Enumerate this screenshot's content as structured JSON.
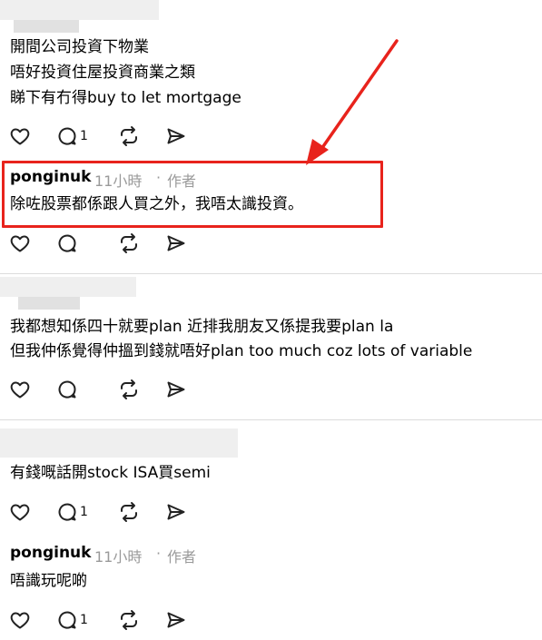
{
  "posts": [
    {
      "lines": [
        "開間公司投資下物業",
        "唔好投資住屋投資商業之類",
        "睇下有冇得buy to let mortgage"
      ],
      "reply_count": "1"
    },
    {
      "username": "ponginuk",
      "time": "11小時",
      "role": "作者",
      "lines": [
        "除咗股票都係跟人買之外，我唔太識投資。"
      ],
      "reply_count": ""
    },
    {
      "lines": [
        "我都想知係四十就要plan 近排我朋友又係提我要plan la",
        "但我仲係覺得仲搵到錢就唔好plan too much coz lots of variable"
      ],
      "reply_count": ""
    },
    {
      "lines": [
        "有錢嘅話開stock ISA買semi"
      ],
      "reply_count": "1"
    },
    {
      "username": "ponginuk",
      "time": "11小時",
      "role": "作者",
      "lines": [
        "唔識玩呢啲"
      ],
      "reply_count": "1"
    }
  ],
  "separator": "·",
  "icons": [
    "heart-icon",
    "comment-icon",
    "repost-icon",
    "share-icon"
  ],
  "colors": {
    "highlight": "#e8231c",
    "meta": "#9a9a9a"
  }
}
